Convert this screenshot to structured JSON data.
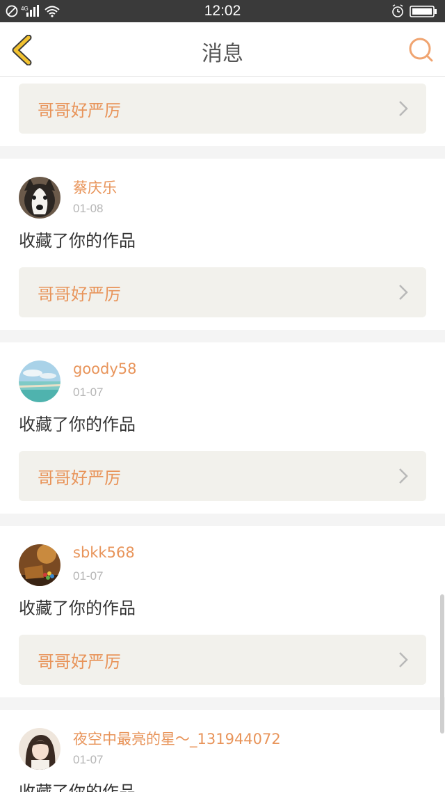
{
  "status_bar": {
    "time": "12:02",
    "network": "4G"
  },
  "header": {
    "title": "消息"
  },
  "colors": {
    "accent": "#e8945a",
    "back_icon": "#f2c230",
    "card_box": "#f2f1ec",
    "status_bar_bg": "#3a3a3a"
  },
  "messages": [
    {
      "username": "",
      "date": "",
      "action": "",
      "work_title": "哥哥好严厉"
    },
    {
      "username": "蔡庆乐",
      "date": "01-08",
      "action": "收藏了你的作品",
      "work_title": "哥哥好严厉",
      "avatar": "husky-dog-avatar"
    },
    {
      "username": "goody58",
      "date": "01-07",
      "action": "收藏了你的作品",
      "work_title": "哥哥好严厉",
      "avatar": "beach-avatar"
    },
    {
      "username": "sbkk568",
      "date": "01-07",
      "action": "收藏了你的作品",
      "work_title": "哥哥好严厉",
      "avatar": "candy-jar-avatar"
    },
    {
      "username": "夜空中最亮的星～_131944072",
      "date": "01-07",
      "action": "收藏了你的作品",
      "work_title": "",
      "avatar": "girl-avatar"
    }
  ]
}
